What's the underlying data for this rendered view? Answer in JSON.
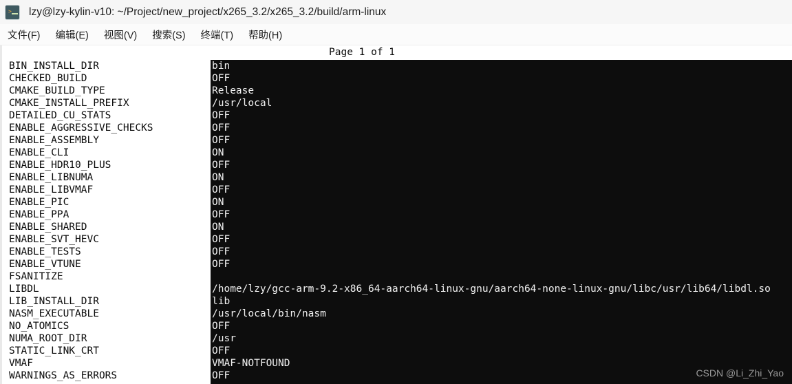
{
  "window": {
    "title": "lzy@lzy-kylin-v10: ~/Project/new_project/x265_3.2/x265_3.2/build/arm-linux",
    "icon": "terminal-icon"
  },
  "menubar": {
    "items": [
      {
        "label": "文件(F)",
        "name": "menu-file"
      },
      {
        "label": "编辑(E)",
        "name": "menu-edit"
      },
      {
        "label": "视图(V)",
        "name": "menu-view"
      },
      {
        "label": "搜索(S)",
        "name": "menu-search"
      },
      {
        "label": "终端(T)",
        "name": "menu-terminal"
      },
      {
        "label": "帮助(H)",
        "name": "menu-help"
      }
    ]
  },
  "terminal": {
    "header": "Page 1 of 1",
    "colors": {
      "background": "#ffffff",
      "foreground": "#0b0b0b",
      "inverse_background": "#0d0d0d",
      "inverse_foreground": "#f2f2f2"
    },
    "rows": [
      {
        "key": "BIN_INSTALL_DIR",
        "value": "bin"
      },
      {
        "key": "CHECKED_BUILD",
        "value": "OFF"
      },
      {
        "key": "CMAKE_BUILD_TYPE",
        "value": "Release"
      },
      {
        "key": "CMAKE_INSTALL_PREFIX",
        "value": "/usr/local"
      },
      {
        "key": "DETAILED_CU_STATS",
        "value": "OFF"
      },
      {
        "key": "ENABLE_AGGRESSIVE_CHECKS",
        "value": "OFF"
      },
      {
        "key": "ENABLE_ASSEMBLY",
        "value": "OFF"
      },
      {
        "key": "ENABLE_CLI",
        "value": "ON"
      },
      {
        "key": "ENABLE_HDR10_PLUS",
        "value": "OFF"
      },
      {
        "key": "ENABLE_LIBNUMA",
        "value": "ON"
      },
      {
        "key": "ENABLE_LIBVMAF",
        "value": "OFF"
      },
      {
        "key": "ENABLE_PIC",
        "value": "ON"
      },
      {
        "key": "ENABLE_PPA",
        "value": "OFF"
      },
      {
        "key": "ENABLE_SHARED",
        "value": "ON"
      },
      {
        "key": "ENABLE_SVT_HEVC",
        "value": "OFF"
      },
      {
        "key": "ENABLE_TESTS",
        "value": "OFF"
      },
      {
        "key": "ENABLE_VTUNE",
        "value": "OFF"
      },
      {
        "key": "FSANITIZE",
        "value": ""
      },
      {
        "key": "LIBDL",
        "value": "/home/lzy/gcc-arm-9.2-x86_64-aarch64-linux-gnu/aarch64-none-linux-gnu/libc/usr/lib64/libdl.so"
      },
      {
        "key": "LIB_INSTALL_DIR",
        "value": "lib"
      },
      {
        "key": "NASM_EXECUTABLE",
        "value": "/usr/local/bin/nasm"
      },
      {
        "key": "NO_ATOMICS",
        "value": "OFF"
      },
      {
        "key": "NUMA_ROOT_DIR",
        "value": "/usr"
      },
      {
        "key": "STATIC_LINK_CRT",
        "value": "OFF"
      },
      {
        "key": "VMAF",
        "value": "VMAF-NOTFOUND"
      },
      {
        "key": "WARNINGS_AS_ERRORS",
        "value": "OFF"
      }
    ]
  },
  "watermark": {
    "text": "CSDN @Li_Zhi_Yao"
  }
}
